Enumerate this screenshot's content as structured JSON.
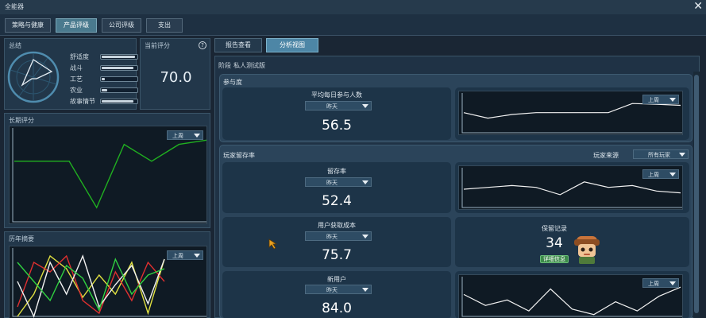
{
  "window": {
    "title": "全能器",
    "close_icon": "close-icon"
  },
  "topnav": {
    "tabs": [
      "策略与健康",
      "产品评级",
      "公司评级",
      "支出"
    ],
    "active_index": 1
  },
  "summary": {
    "title": "总结",
    "stats": [
      {
        "label": "舒适度",
        "value": 0.95
      },
      {
        "label": "战斗",
        "value": 0.9
      },
      {
        "label": "工艺",
        "value": 0.1
      },
      {
        "label": "农业",
        "value": 0.15
      },
      {
        "label": "故事情节",
        "value": 0.9
      }
    ]
  },
  "current_score": {
    "title": "当前评分",
    "value": "70.0",
    "help_icon": "question-icon"
  },
  "long_term": {
    "title": "长期评分",
    "dropdown": "上周",
    "chart_data": {
      "type": "line",
      "values": [
        70,
        70,
        70,
        15,
        90,
        70,
        90,
        95
      ],
      "ylim": [
        0,
        100
      ]
    }
  },
  "history": {
    "title": "历年摘要",
    "dropdown": "上周",
    "chart_data": {
      "type": "line",
      "ylim": [
        0,
        100
      ],
      "series": [
        {
          "color": "#e0e040",
          "values": [
            5,
            40,
            100,
            80,
            35,
            70,
            40,
            90,
            10,
            95
          ]
        },
        {
          "color": "#e03030",
          "values": [
            20,
            90,
            75,
            100,
            30,
            10,
            75,
            30,
            90,
            60
          ]
        },
        {
          "color": "#f2f2f2",
          "values": [
            60,
            5,
            90,
            40,
            100,
            20,
            55,
            85,
            25,
            95
          ]
        },
        {
          "color": "#30d040",
          "values": [
            90,
            60,
            30,
            85,
            65,
            15,
            95,
            40,
            70,
            80
          ]
        }
      ]
    }
  },
  "tabs": {
    "items": [
      "报告查看",
      "分析视图"
    ],
    "active_index": 1
  },
  "stage": {
    "label": "阶段",
    "value": "私人测试版"
  },
  "participation": {
    "title": "参与度",
    "metric_title": "平均每日参与人数",
    "period": "昨天",
    "value": "56.5",
    "chart_dropdown": "上周",
    "chart_data": {
      "type": "line",
      "values": [
        55,
        40,
        50,
        55,
        55,
        55,
        55,
        80,
        78,
        75
      ],
      "ylim": [
        0,
        100
      ]
    }
  },
  "retention": {
    "title": "玩家留存率",
    "source_label": "玩家来源",
    "source_value": "所有玩家",
    "retention_metric": {
      "title": "留存率",
      "period": "昨天",
      "value": "52.4",
      "chart_dropdown": "上周",
      "chart_data": {
        "type": "line",
        "values": [
          50,
          55,
          60,
          55,
          35,
          70,
          55,
          60,
          45,
          40
        ],
        "ylim": [
          0,
          100
        ]
      }
    },
    "acquisition_cost": {
      "title": "用户获取成本",
      "period": "昨天",
      "value": "75.7"
    },
    "retained_records": {
      "title": "保留记录",
      "value": "34",
      "button": "详细信息"
    },
    "new_users": {
      "title": "新用户",
      "period": "昨天",
      "value": "84.0",
      "chart_dropdown": "上周",
      "chart_data": {
        "type": "line",
        "values": [
          60,
          30,
          45,
          15,
          75,
          20,
          5,
          40,
          15,
          55,
          80
        ],
        "ylim": [
          0,
          100
        ]
      }
    }
  }
}
